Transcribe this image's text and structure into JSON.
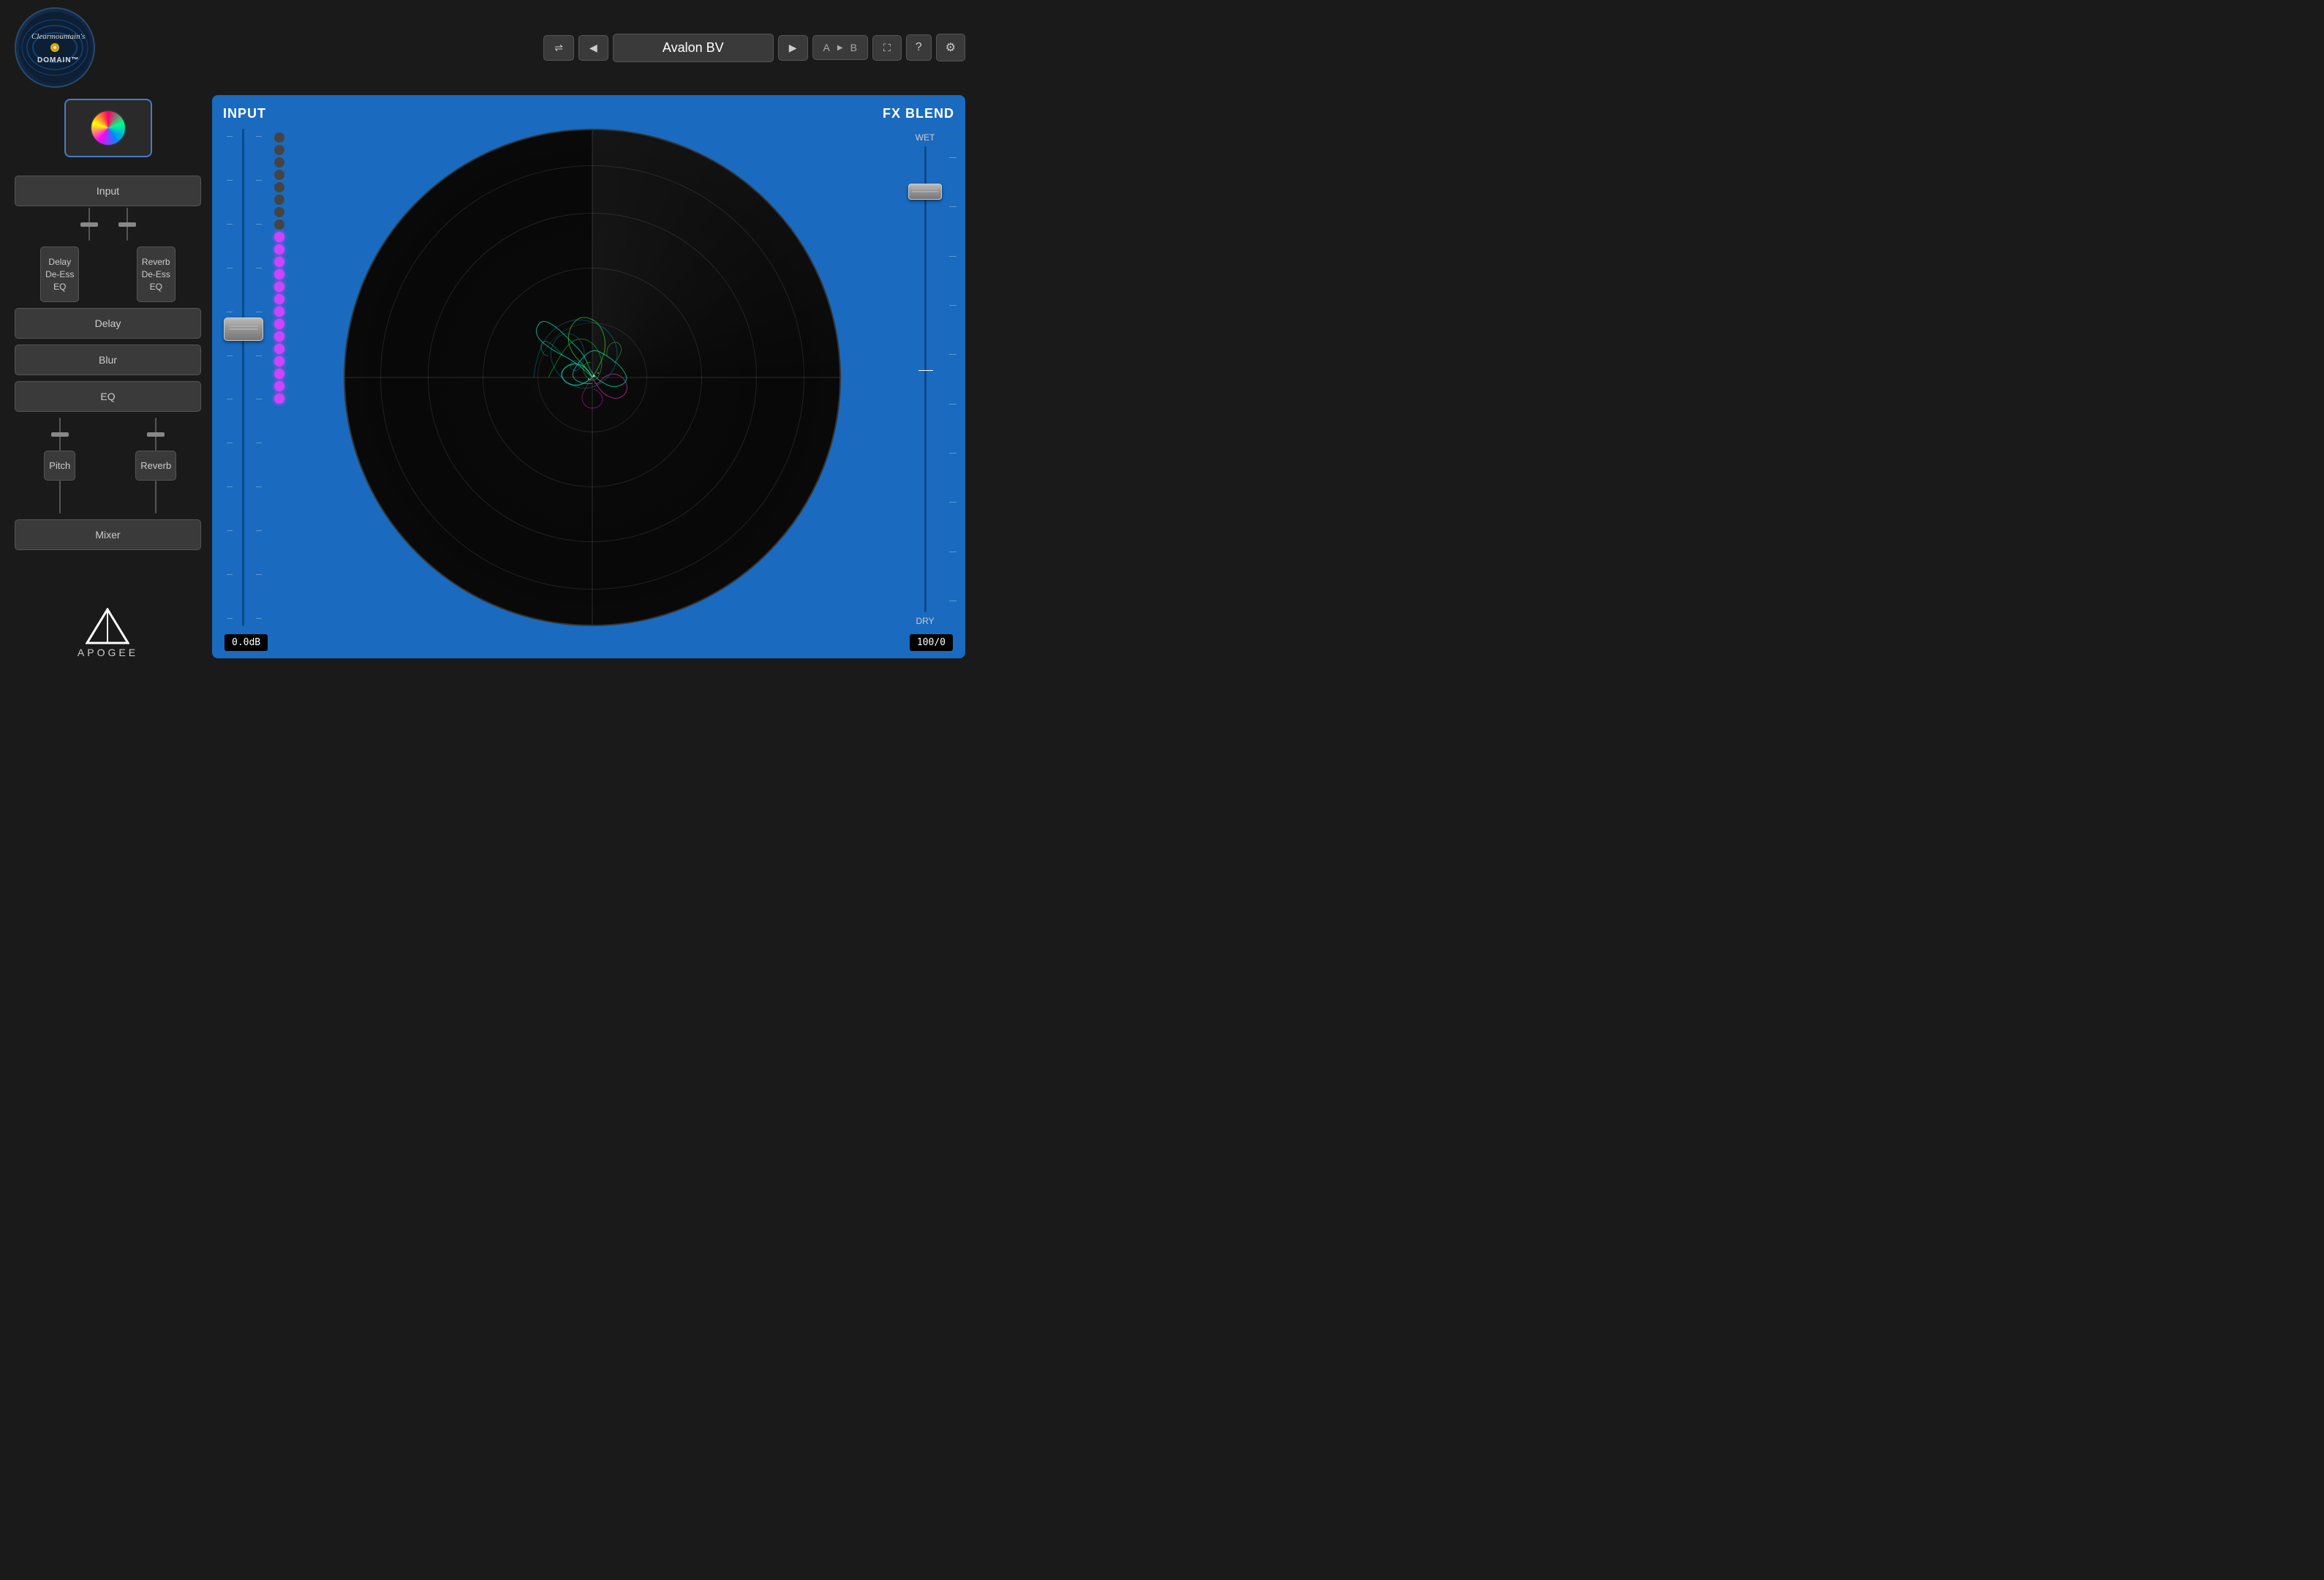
{
  "app": {
    "title": "Clearmountain's Domain"
  },
  "header": {
    "logo_brand": "Clearmountain's",
    "logo_domain": "DOMAIN™",
    "shuffle_icon": "⇌",
    "prev_icon": "◀",
    "next_icon": "▶",
    "preset_name": "Avalon BV",
    "ab_a": "A",
    "ab_play": "▶",
    "ab_b": "B",
    "expand_icon": "⛶",
    "help_icon": "?",
    "settings_icon": "⚙"
  },
  "sidebar": {
    "input_label": "Input",
    "delay_de_ess_eq_label": "Delay\nDe-Ess\nEQ",
    "reverb_de_ess_eq_label": "Reverb\nDe-Ess\nEQ",
    "delay_label": "Delay",
    "blur_label": "Blur",
    "eq_label": "EQ",
    "pitch_label": "Pitch",
    "reverb_label": "Reverb",
    "mixer_label": "Mixer",
    "apogee_label": "APOGEE"
  },
  "main_panel": {
    "input_label": "INPUT",
    "fx_blend_label": "FX BLEND",
    "wet_label": "WET",
    "dry_label": "DRY",
    "input_db_value": "0.0dB",
    "fx_value": "100/0"
  },
  "vu_meter": {
    "active_dots": 14,
    "total_dots": 22
  },
  "colors": {
    "background": "#1a1a1a",
    "panel_blue": "#1a6abf",
    "button_dark": "#3a3a3a",
    "accent_purple": "#cc44ff",
    "fader_light": "#999999",
    "text_white": "#ffffff",
    "text_gray": "#cccccc"
  }
}
